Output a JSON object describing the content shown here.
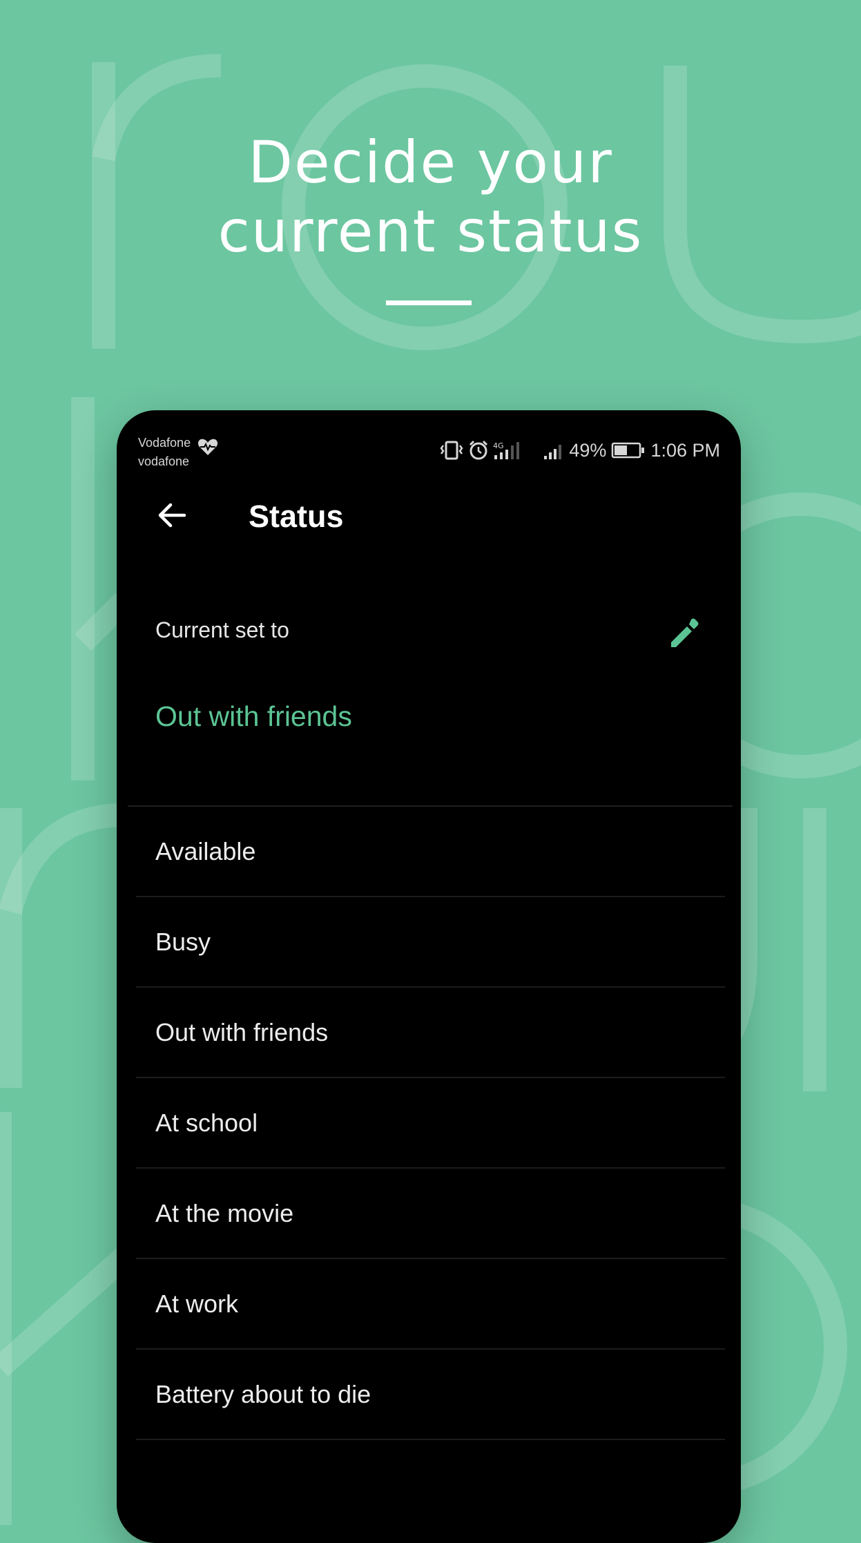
{
  "headline": {
    "line1": "Decide your",
    "line2": "current status"
  },
  "status_bar": {
    "carrier_line1": "Vodafone",
    "carrier_line2": "vodafone",
    "battery": "49%",
    "time": "1:06 PM",
    "icons": [
      "heart-rate-icon",
      "vibrate-icon",
      "alarm-icon",
      "signal-4g-icon",
      "signal-icon",
      "battery-icon"
    ]
  },
  "app_bar": {
    "title": "Status",
    "back_icon": "arrow-left-icon"
  },
  "current": {
    "label": "Current set to",
    "value": "Out with friends",
    "edit_icon": "pencil-icon"
  },
  "statuses": [
    "Available",
    "Busy",
    "Out with friends",
    "At school",
    "At the movie",
    "At work",
    "Battery about to die"
  ],
  "colors": {
    "background": "#6cc6a0",
    "accent": "#5cc494",
    "phone": "#000000"
  }
}
